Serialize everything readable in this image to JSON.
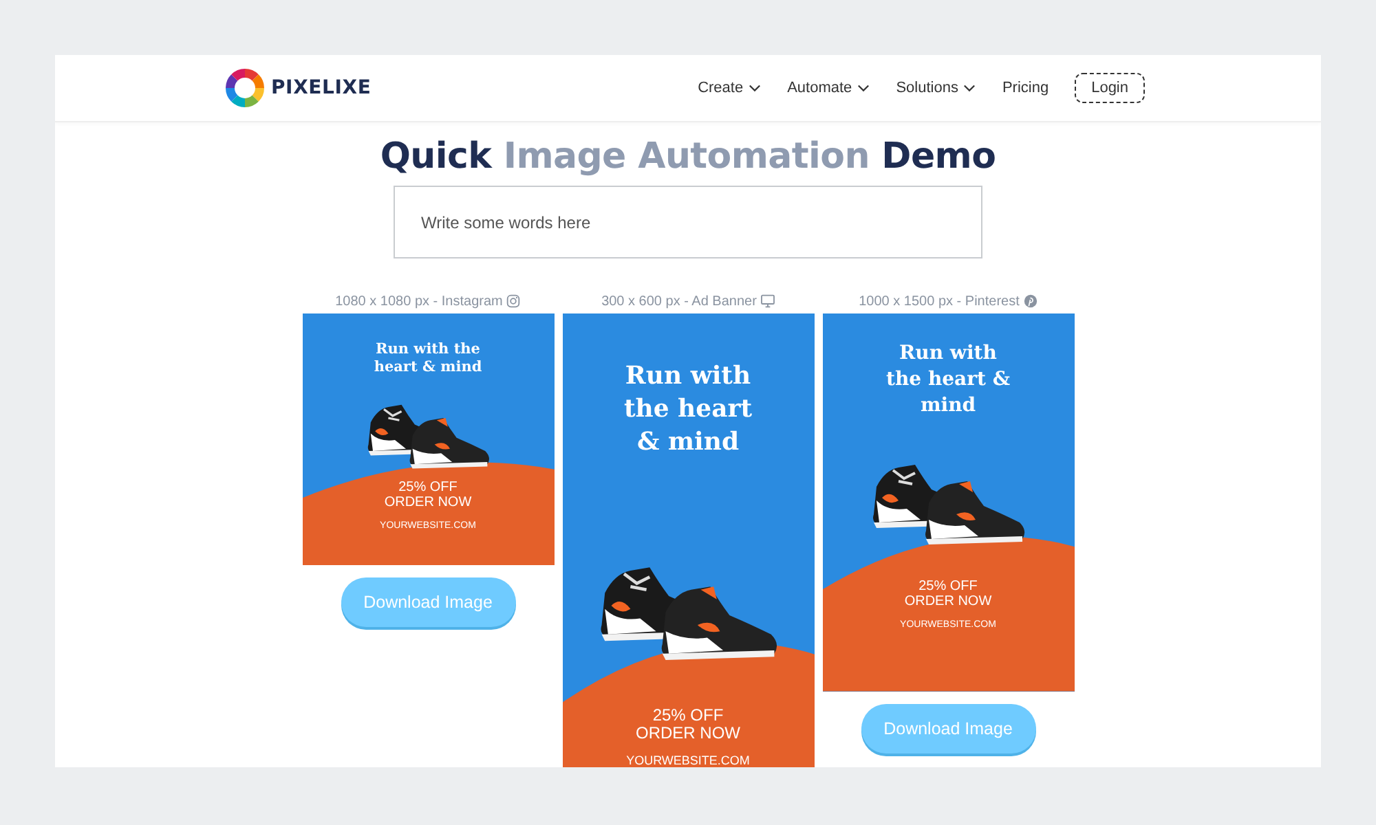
{
  "navbar": {
    "logo_text": "PIXELIXE",
    "menu": [
      {
        "label": "Create",
        "dropdown": true
      },
      {
        "label": "Automate",
        "dropdown": true
      },
      {
        "label": "Solutions",
        "dropdown": true
      },
      {
        "label": "Pricing",
        "dropdown": false
      }
    ],
    "login": "Login"
  },
  "title_parts": [
    {
      "text": "Quick",
      "highlighted": false
    },
    {
      "text": "Image Automation",
      "highlighted": true
    },
    {
      "text": "Demo",
      "highlighted": false
    }
  ],
  "text_input": {
    "placeholder": "Write some words here"
  },
  "cards": [
    {
      "label": "1080 x 1080 px - Instagram",
      "kind": "instagram",
      "headline": "Run with the heart & mind",
      "offer": "25% OFF",
      "cta": "ORDER NOW",
      "website": "YOURWEBSITE.COM",
      "button": "Download Image"
    },
    {
      "label": "300 x 600 px - Ad Banner",
      "kind": "banner",
      "headline": "Run with the heart & mind",
      "offer": "25% OFF",
      "cta": "ORDER NOW",
      "website": "YOURWEBSITE.COM"
    },
    {
      "label": "1000 x 1500 px - Pinterest",
      "kind": "pinterest",
      "headline": "Run with the heart & mind",
      "offer": "25% OFF",
      "cta": "ORDER NOW",
      "website": "YOURWEBSITE.COM",
      "button": "Download Image"
    }
  ]
}
